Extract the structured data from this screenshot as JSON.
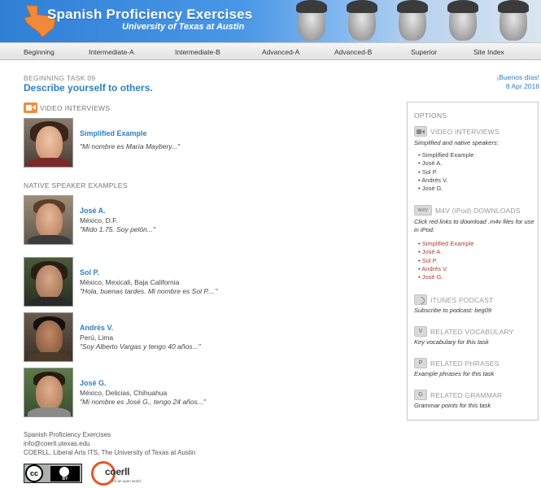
{
  "header": {
    "title": "Spanish Proficiency Exercises",
    "subtitle": "University of Texas at Austin"
  },
  "nav": {
    "items": [
      "Beginning",
      "Intermediate-A",
      "Intermediate-B",
      "Advanced-A",
      "Advanced-B",
      "Superior",
      "Site Index"
    ]
  },
  "task": {
    "label": "BEGINNING TASK 09",
    "title": "Describe yourself to others.",
    "greeting": "¡Buenos días!",
    "date": "8 Apr 2018"
  },
  "sections": {
    "video_interviews": "VIDEO INTERVIEWS",
    "native_examples": "NATIVE SPEAKER EXAMPLES"
  },
  "simplified": {
    "name": "Simplified Example",
    "quote": "\"Mi nombre es María Maybery...\""
  },
  "speakers": [
    {
      "name": "José A.",
      "location": "México, D.F.",
      "quote": "\"Mido 1.75. Soy pelón...\""
    },
    {
      "name": "Sol P.",
      "location": "México, Mexicali, Baja California",
      "quote": "\"Hola, buenas tardes. Mi nombre es Sol P....\""
    },
    {
      "name": "Andrés V.",
      "location": "Perú, Lima",
      "quote": "\"Soy Alberto Vargas y tengo 40 años...\""
    },
    {
      "name": "José G.",
      "location": "México, Delicias, Chihuahua",
      "quote": "\"Mi nombre es José G., tengo 24 años...\""
    }
  ],
  "footer": {
    "line1": "Spanish Proficiency Exercises",
    "line2": "info@coerll.utexas.edu",
    "line3": "COERLL, Liberal Arts ITS, The University of Texas at Austin",
    "cc_mark": "cc",
    "cc_by": "BY",
    "coerll_word": "coerll",
    "coerll_tag": "for an open world"
  },
  "options": {
    "title": "OPTIONS",
    "video": {
      "head": "VIDEO INTERVIEWS",
      "desc": "Simplified and native speakers:",
      "items": [
        "Simplified Example",
        "José A.",
        "Sol P.",
        "Andrés V.",
        "José G."
      ]
    },
    "m4v": {
      "icon_text": "M4V",
      "head": "M4V (iPod) DOWNLOADS",
      "desc": "Click red links to download .m4v files for use in iPod:",
      "items": [
        "Simplified Example",
        "José A.",
        "Sol P.",
        "Andrés V.",
        "José G."
      ]
    },
    "podcast": {
      "head": "ITUNES PODCAST",
      "desc": "Subscribe to podcast: beg09"
    },
    "vocab": {
      "icon": "V",
      "head": "RELATED VOCABULARY",
      "desc": "Key vocabulary for this task"
    },
    "phrases": {
      "icon": "P",
      "head": "RELATED PHRASES",
      "desc": "Example phrases for this task"
    },
    "grammar": {
      "icon": "G",
      "head": "RELATED GRAMMAR",
      "desc": "Grammar points for this task"
    }
  }
}
